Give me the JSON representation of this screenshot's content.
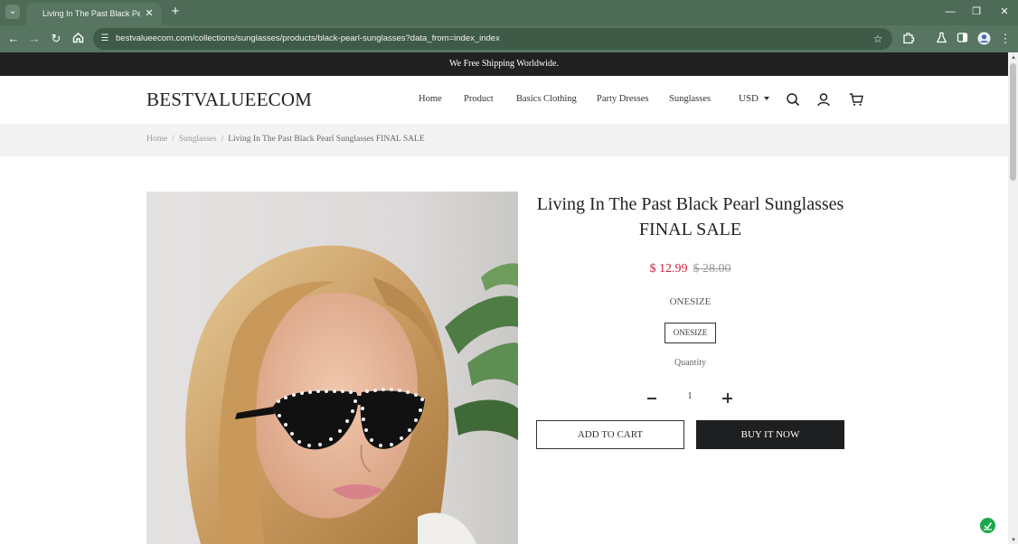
{
  "browser": {
    "tab_title": "Living In The Past Black Pearl Sunglasses",
    "url": "bestvalueecom.com/collections/sunglasses/products/black-pearl-sunglasses?data_from=index_index"
  },
  "announcement": "We Free Shipping Worldwide.",
  "header": {
    "logo": "BESTVALUEECOM",
    "nav": [
      "Home",
      "Product",
      "Basics Clothing",
      "Party Dresses",
      "Sunglasses"
    ],
    "currency": "USD"
  },
  "breadcrumb": {
    "items": [
      "Home",
      "Sunglasses"
    ],
    "current": "Living In The Past Black Pearl Sunglasses FINAL SALE"
  },
  "product": {
    "title_line1": "Living In The Past Black Pearl Sunglasses",
    "title_line2": "FINAL SALE",
    "sale_price": "$ 12.99",
    "original_price": "$ 28.00",
    "size_label": "ONESIZE",
    "size_option": "ONESIZE",
    "quantity_label": "Quantity",
    "quantity": "1",
    "add_to_cart": "ADD TO CART",
    "buy_now": "BUY IT NOW"
  },
  "colors": {
    "browser_frame": "#577561",
    "announcement_bg": "#212121",
    "sale_price": "#d0213c",
    "buy_button": "#1e1f21"
  }
}
